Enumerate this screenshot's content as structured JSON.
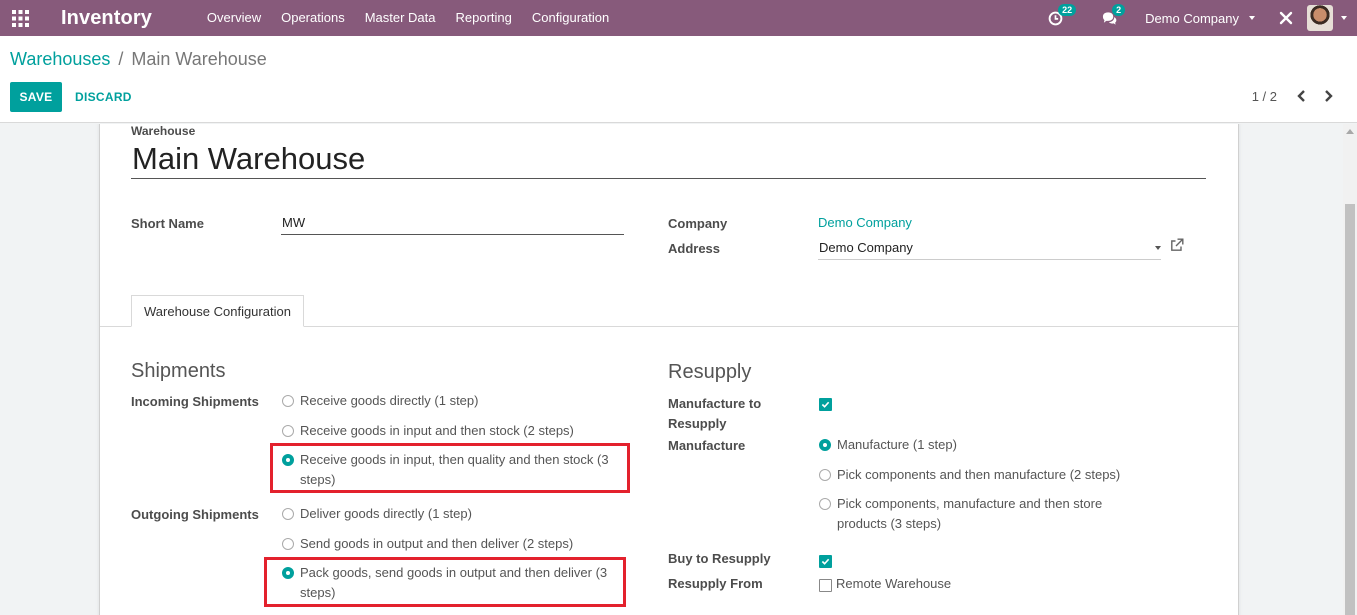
{
  "app": {
    "title": "Inventory",
    "menu": [
      "Overview",
      "Operations",
      "Master Data",
      "Reporting",
      "Configuration"
    ],
    "activity_badge": "22",
    "messages_badge": "2",
    "company": "Demo Company"
  },
  "breadcrumb": {
    "parent": "Warehouses",
    "separator": "/",
    "current": "Main Warehouse"
  },
  "actions": {
    "save": "SAVE",
    "discard": "DISCARD"
  },
  "pager": {
    "value": "1 / 2"
  },
  "form": {
    "warehouse_label": "Warehouse",
    "warehouse_name": "Main Warehouse",
    "short_name_label": "Short Name",
    "short_name_value": "MW",
    "company_label": "Company",
    "company_value": "Demo Company",
    "address_label": "Address",
    "address_value": "Demo Company",
    "tab": "Warehouse Configuration",
    "shipments": {
      "title": "Shipments",
      "incoming_label": "Incoming Shipments",
      "incoming_options": [
        {
          "line1": "Receive goods directly (1 step)",
          "line2": "",
          "selected": false
        },
        {
          "line1": "Receive goods in input and then stock (2 steps)",
          "line2": "",
          "selected": false
        },
        {
          "line1": "Receive goods in input, then quality and then stock (3",
          "line2": "steps)",
          "selected": true
        }
      ],
      "outgoing_label": "Outgoing Shipments",
      "outgoing_options": [
        {
          "line1": "Deliver goods directly (1 step)",
          "line2": "",
          "selected": false
        },
        {
          "line1": "Send goods in output and then deliver (2 steps)",
          "line2": "",
          "selected": false
        },
        {
          "line1": "Pack goods, send goods in output and then deliver (3",
          "line2": "steps)",
          "selected": true
        }
      ]
    },
    "resupply": {
      "title": "Resupply",
      "manufacture_to_resupply_label_1": "Manufacture to",
      "manufacture_to_resupply_label_2": "Resupply",
      "manufacture_to_resupply": true,
      "manufacture_label": "Manufacture",
      "manufacture_options": [
        {
          "line1": "Manufacture (1 step)",
          "line2": "",
          "selected": true
        },
        {
          "line1": "Pick components and then manufacture (2 steps)",
          "line2": "",
          "selected": false
        },
        {
          "line1": "Pick components, manufacture and then store",
          "line2": "products (3 steps)",
          "selected": false
        }
      ],
      "buy_to_resupply_label": "Buy to Resupply",
      "buy_to_resupply": true,
      "resupply_from_label": "Resupply From",
      "resupply_from_option": "Remote Warehouse",
      "resupply_from_checked": false
    }
  },
  "colors": {
    "navbar": "#875a7b",
    "accent": "#00a09d",
    "highlight": "#e3212d"
  }
}
